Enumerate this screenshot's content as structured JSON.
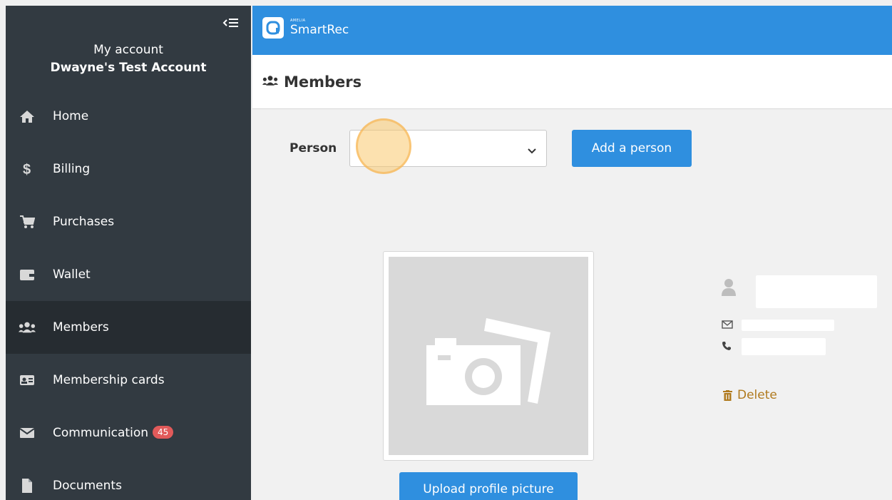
{
  "sidebar": {
    "account_label": "My account",
    "account_name": "Dwayne's Test Account",
    "items": [
      {
        "label": "Home",
        "icon": "home-icon"
      },
      {
        "label": "Billing",
        "icon": "dollar-icon"
      },
      {
        "label": "Purchases",
        "icon": "cart-icon"
      },
      {
        "label": "Wallet",
        "icon": "wallet-icon"
      },
      {
        "label": "Members",
        "icon": "users-icon",
        "active": true
      },
      {
        "label": "Membership cards",
        "icon": "id-card-icon"
      },
      {
        "label": "Communication",
        "icon": "envelope-icon",
        "badge": "45"
      },
      {
        "label": "Documents",
        "icon": "file-icon"
      }
    ]
  },
  "topbar": {
    "brand_small": "AMELIA",
    "brand_name": "SmartRec"
  },
  "header": {
    "title": "Members"
  },
  "main": {
    "person_label": "Person",
    "person_select_value": "",
    "add_person_label": "Add a person",
    "upload_label": "Upload profile picture",
    "delete_label": "Delete"
  },
  "colors": {
    "sidebar_bg": "#323a41",
    "sidebar_active_bg": "#262c31",
    "accent_blue": "#2f8fdf",
    "badge_red": "#e15a5a",
    "delete_brown": "#b07a1e"
  }
}
